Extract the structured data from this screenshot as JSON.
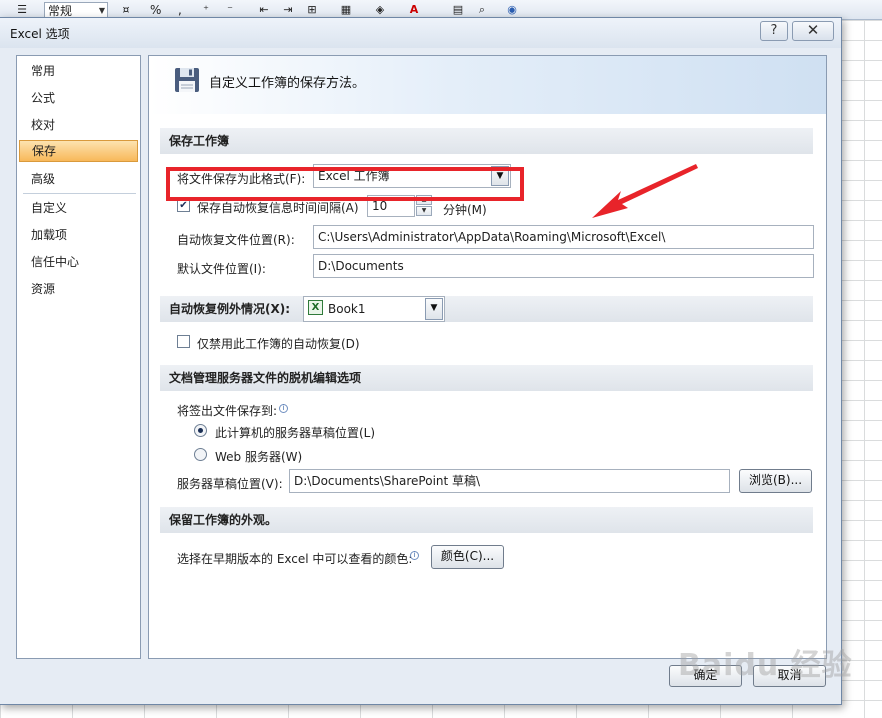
{
  "excel": {
    "number_format": "常规",
    "percent_symbol": "%",
    "comma_symbol": ","
  },
  "dialog": {
    "title": "Excel 选项",
    "help_glyph": "?",
    "close_glyph": "✕",
    "ok_label": "确定",
    "cancel_label": "取消"
  },
  "nav": {
    "items": [
      "常用",
      "公式",
      "校对",
      "保存",
      "高级",
      "自定义",
      "加载项",
      "信任中心",
      "资源"
    ],
    "selected": "保存"
  },
  "header": {
    "text": "自定义工作簿的保存方法。"
  },
  "save_section": {
    "title": "保存工作簿",
    "format_label": "将文件保存为此格式(F):",
    "format_value": "Excel 工作簿",
    "autorecover_label": "保存自动恢复信息时间间隔(A)",
    "autorecover_checked": true,
    "autorecover_minutes": "10",
    "minutes_label": "分钟(M)",
    "autorecover_location_label": "自动恢复文件位置(R):",
    "autorecover_location_value": "C:\\Users\\Administrator\\AppData\\Roaming\\Microsoft\\Excel\\",
    "default_location_label": "默认文件位置(I):",
    "default_location_value": "D:\\Documents"
  },
  "exception_section": {
    "title": "自动恢复例外情况(X):",
    "workbook_value": "Book1",
    "disable_label": "仅禁用此工作簿的自动恢复(D)",
    "disable_checked": false
  },
  "server_section": {
    "title": "文档管理服务器文件的脱机编辑选项",
    "save_to_label": "将签出文件保存到:",
    "radio_local_label": "此计算机的服务器草稿位置(L)",
    "radio_web_label": "Web 服务器(W)",
    "selected_radio": "local",
    "drafts_label": "服务器草稿位置(V):",
    "drafts_value": "D:\\Documents\\SharePoint 草稿\\",
    "browse_label": "浏览(B)..."
  },
  "visual_section": {
    "title": "保留工作簿的外观。",
    "colors_label": "选择在早期版本的 Excel 中可以查看的颜色:",
    "colors_button": "颜色(C)..."
  },
  "watermark": {
    "text": "Baidu 经验"
  },
  "colors": {
    "highlight": "#e8242a",
    "selected_nav": "#f8b85a",
    "header_gradient": "#cfe0f2"
  },
  "icons": [
    "save-disk-icon",
    "info-icon",
    "excel-workbook-icon",
    "dropdown-arrow-icon",
    "checkbox-check-icon"
  ]
}
